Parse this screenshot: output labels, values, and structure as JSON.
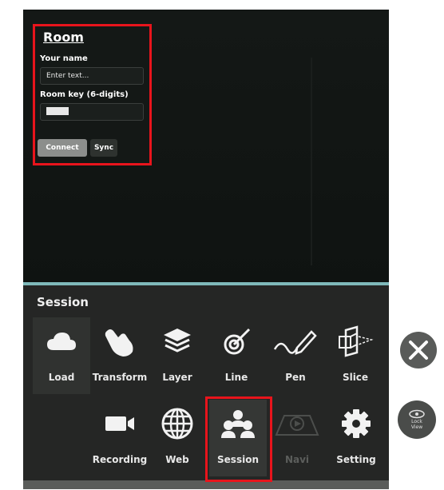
{
  "room": {
    "title": "Room",
    "name_label": "Your name",
    "name_placeholder": "Enter text...",
    "key_label": "Room key (6-digits)",
    "connect_label": "Connect",
    "sync_label": "Sync"
  },
  "session": {
    "title": "Session",
    "row1": [
      {
        "label": "Load",
        "icon": "cloud-icon"
      },
      {
        "label": "Transform",
        "icon": "hand-icon"
      },
      {
        "label": "Layer",
        "icon": "layers-icon"
      },
      {
        "label": "Line",
        "icon": "line-tool-icon"
      },
      {
        "label": "Pen",
        "icon": "pen-icon"
      },
      {
        "label": "Slice",
        "icon": "slice-icon"
      }
    ],
    "row2": [
      {
        "label": "Recording",
        "icon": "video-camera-icon"
      },
      {
        "label": "Web",
        "icon": "globe-icon"
      },
      {
        "label": "Session",
        "icon": "users-icon"
      },
      {
        "label": "Navi",
        "icon": "navi-icon",
        "disabled": true
      },
      {
        "label": "Setting",
        "icon": "gear-icon"
      }
    ]
  },
  "side": {
    "close_icon": "close-icon",
    "lock_view_label_1": "Lock",
    "lock_view_label_2": "View"
  },
  "colors": {
    "highlight": "#e8141c",
    "divider": "#7fb9ba"
  }
}
